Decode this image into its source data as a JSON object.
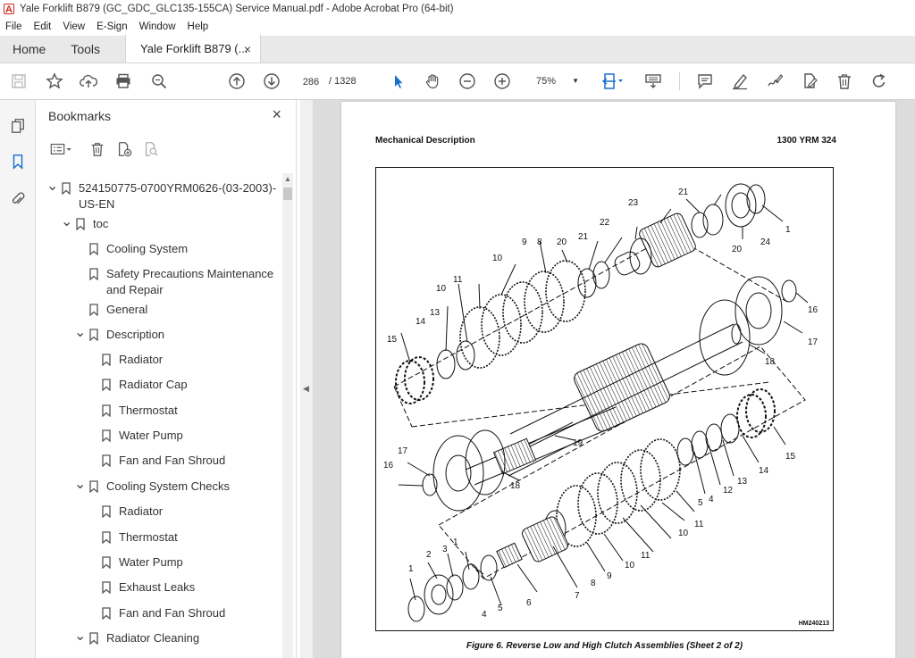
{
  "window": {
    "title": "Yale Forklift B879 (GC_GDC_GLC135-155CA) Service Manual.pdf - Adobe Acrobat Pro (64-bit)"
  },
  "menu": [
    "File",
    "Edit",
    "View",
    "E-Sign",
    "Window",
    "Help"
  ],
  "tabs": {
    "home": "Home",
    "tools": "Tools",
    "document": "Yale Forklift B879 (...",
    "close": "×"
  },
  "toolbar": {
    "current_page": "286",
    "page_total": "/ 1328",
    "zoom": "75%"
  },
  "bookmarks": {
    "title": "Bookmarks",
    "close": "×",
    "items": [
      {
        "label": "524150775-0700YRM0626-(03-2003)-",
        "label2": "US-EN",
        "level": 0,
        "expanded": true
      },
      {
        "label": "toc",
        "level": 1,
        "expanded": true
      },
      {
        "label": "Cooling System",
        "level": 2
      },
      {
        "label": "Safety Precautions Maintenance",
        "label2": "and Repair",
        "level": 2
      },
      {
        "label": "General",
        "level": 2
      },
      {
        "label": "Description",
        "level": 2,
        "expanded": true
      },
      {
        "label": "Radiator",
        "level": 3
      },
      {
        "label": "Radiator Cap",
        "level": 3
      },
      {
        "label": "Thermostat",
        "level": 3
      },
      {
        "label": "Water Pump",
        "level": 3
      },
      {
        "label": "Fan and Fan Shroud",
        "level": 3
      },
      {
        "label": "Cooling System Checks",
        "level": 2,
        "expanded": true
      },
      {
        "label": "Radiator",
        "level": 3
      },
      {
        "label": "Thermostat",
        "level": 3
      },
      {
        "label": "Water Pump",
        "level": 3
      },
      {
        "label": "Exhaust Leaks",
        "level": 3
      },
      {
        "label": "Fan and Fan Shroud",
        "level": 3
      },
      {
        "label": "Radiator Cleaning",
        "level": 2,
        "expanded": true
      }
    ]
  },
  "document": {
    "header_left": "Mechanical Description",
    "header_right": "1300 YRM 324",
    "figure_id": "HM240213",
    "caption": "Figure 6.  Reverse Low and High Clutch Assemblies (Sheet 2 of 2)"
  }
}
